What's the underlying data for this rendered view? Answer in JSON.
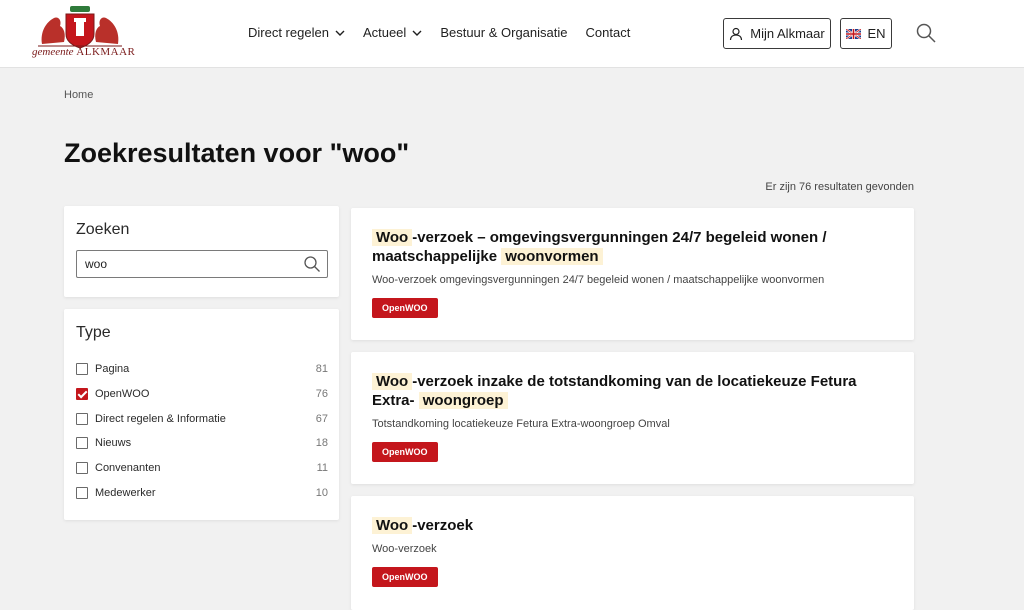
{
  "header": {
    "logo_text": "gemeente",
    "logo_brand": "ALKMAAR",
    "nav": [
      {
        "label": "Direct regelen",
        "has_dropdown": true
      },
      {
        "label": "Actueel",
        "has_dropdown": true
      },
      {
        "label": "Bestuur & Organisatie",
        "has_dropdown": false
      },
      {
        "label": "Contact",
        "has_dropdown": false
      }
    ],
    "account_label": "Mijn Alkmaar",
    "language_label": "EN"
  },
  "breadcrumb": "Home",
  "page_title": "Zoekresultaten voor \"woo\"",
  "result_count": "Er zijn 76 resultaten gevonden",
  "search_panel": {
    "heading": "Zoeken",
    "value": "woo"
  },
  "type_panel": {
    "heading": "Type",
    "filters": [
      {
        "label": "Pagina",
        "count": "81",
        "checked": false
      },
      {
        "label": "OpenWOO",
        "count": "76",
        "checked": true
      },
      {
        "label": "Direct regelen & Informatie",
        "count": "67",
        "checked": false
      },
      {
        "label": "Nieuws",
        "count": "18",
        "checked": false
      },
      {
        "label": "Convenanten",
        "count": "11",
        "checked": false
      },
      {
        "label": "Medewerker",
        "count": "10",
        "checked": false
      }
    ]
  },
  "results": [
    {
      "title_hl_1": "Woo",
      "title_mid": "-verzoek – omgevingsvergunningen 24/7 begeleid wonen / maatschappelijke",
      "title_hl_2": "woonvormen",
      "title_end": "",
      "description": "Woo-verzoek omgevingsvergunningen 24/7 begeleid wonen / maatschappelijke woonvormen",
      "tag": "OpenWOO"
    },
    {
      "title_hl_1": "Woo",
      "title_mid": "-verzoek inzake de totstandkoming van de locatiekeuze Fetura Extra-",
      "title_hl_2": "woongroep",
      "title_end": "",
      "description": "Totstandkoming locatiekeuze Fetura Extra-woongroep Omval",
      "tag": "OpenWOO"
    },
    {
      "title_hl_1": "Woo",
      "title_mid": "-verzoek",
      "title_hl_2": "",
      "title_end": "",
      "description": "Woo-verzoek",
      "tag": "OpenWOO"
    }
  ],
  "colors": {
    "brand_red": "#c4161c",
    "highlight": "#fdf2d5",
    "background": "#f1f1f1"
  }
}
